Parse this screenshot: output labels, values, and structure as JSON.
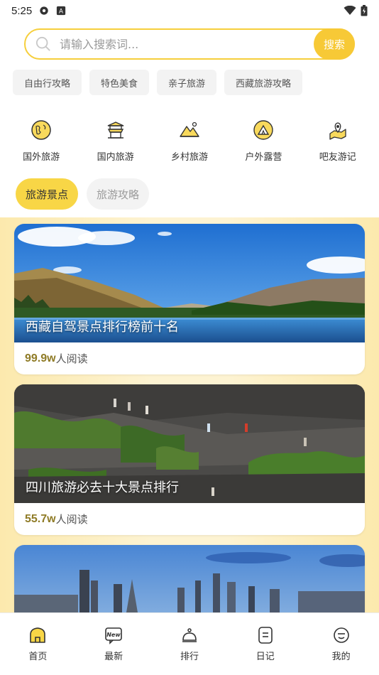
{
  "status_bar": {
    "time": "5:25",
    "icons": [
      "settings-gear-icon",
      "notification-a-icon",
      "wifi-icon",
      "battery-icon"
    ]
  },
  "search": {
    "placeholder": "请输入搜索词...",
    "button_label": "搜索"
  },
  "tags": [
    "自由行攻略",
    "特色美食",
    "亲子旅游",
    "西藏旅游攻略"
  ],
  "categories": [
    {
      "label": "国外旅游",
      "icon": "globe-icon"
    },
    {
      "label": "国内旅游",
      "icon": "temple-icon"
    },
    {
      "label": "乡村旅游",
      "icon": "mountain-icon"
    },
    {
      "label": "户外露营",
      "icon": "tent-icon"
    },
    {
      "label": "吧友游记",
      "icon": "map-pin-icon"
    }
  ],
  "tabs": [
    {
      "label": "旅游景点",
      "active": true
    },
    {
      "label": "旅游攻略",
      "active": false
    }
  ],
  "read_suffix": "人阅读",
  "cards": [
    {
      "title": "西藏自驾景点排行榜前十名",
      "reads": "99.9w"
    },
    {
      "title": "四川旅游必去十大景点排行",
      "reads": "55.7w"
    },
    {
      "title": "",
      "reads": ""
    }
  ],
  "bottom_nav": [
    {
      "label": "首页",
      "icon": "home-icon",
      "active": true
    },
    {
      "label": "最新",
      "icon": "new-badge-icon",
      "active": false
    },
    {
      "label": "排行",
      "icon": "ranking-icon",
      "active": false
    },
    {
      "label": "日记",
      "icon": "diary-icon",
      "active": false
    },
    {
      "label": "我的",
      "icon": "profile-icon",
      "active": false
    }
  ],
  "colors": {
    "accent": "#f7c936",
    "tab_active": "#f8d646",
    "feed_bg": "#fdf3d2",
    "read_count": "#8f7b26"
  }
}
